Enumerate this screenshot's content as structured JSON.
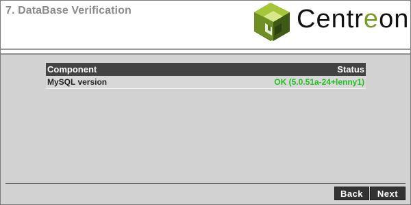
{
  "header": {
    "step_title": "7. DataBase Verification",
    "logo": {
      "text_before": "Centr",
      "text_accent": "e",
      "text_after": "on",
      "accent_color": "#7a9a2a"
    }
  },
  "table": {
    "columns": [
      "Component",
      "Status"
    ],
    "rows": [
      {
        "component": "MySQL version",
        "status": "OK (5.0.51a-24+lenny1)",
        "status_color": "#1fc01f"
      }
    ]
  },
  "footer": {
    "back_label": "Back",
    "next_label": "Next"
  }
}
